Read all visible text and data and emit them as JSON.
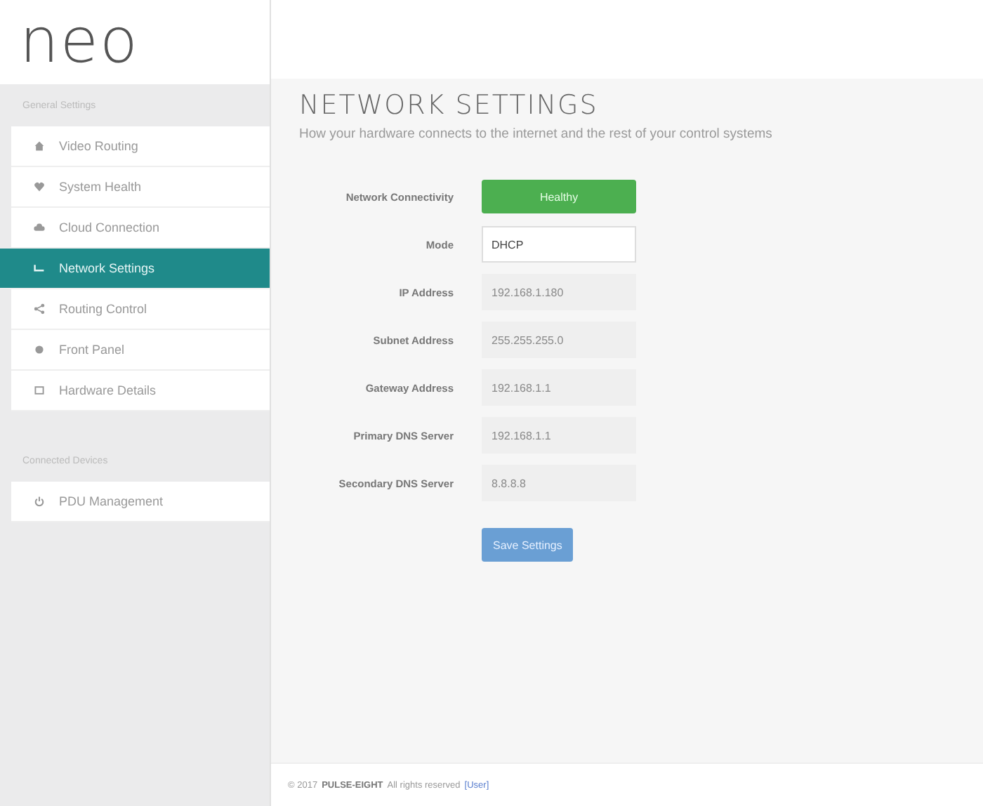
{
  "logo": {
    "text": "neo"
  },
  "sidebar": {
    "sections": [
      {
        "heading": "General Settings",
        "items": [
          {
            "label": "Video Routing",
            "selected": false
          },
          {
            "label": "System Health",
            "selected": false
          },
          {
            "label": "Cloud Connection",
            "selected": false
          },
          {
            "label": "Network Settings",
            "selected": true
          },
          {
            "label": "Routing Control",
            "selected": false
          },
          {
            "label": "Front Panel",
            "selected": false
          },
          {
            "label": "Hardware Details",
            "selected": false
          }
        ]
      },
      {
        "heading": "Connected Devices",
        "items": [
          {
            "label": "PDU Management",
            "selected": false
          }
        ]
      }
    ]
  },
  "page": {
    "title": "NETWORK SETTINGS",
    "subtitle": "How your hardware connects to the internet and the rest of your control systems"
  },
  "form": {
    "rows": [
      {
        "label": "Network Connectivity",
        "kind": "status",
        "value": "Healthy"
      },
      {
        "label": "Mode",
        "kind": "field",
        "value": "DHCP",
        "disabled": false
      },
      {
        "label": "IP Address",
        "kind": "field",
        "value": "192.168.1.180",
        "disabled": true
      },
      {
        "label": "Subnet Address",
        "kind": "field",
        "value": "255.255.255.0",
        "disabled": true
      },
      {
        "label": "Gateway Address",
        "kind": "field",
        "value": "192.168.1.1",
        "disabled": true
      },
      {
        "label": "Primary DNS Server",
        "kind": "field",
        "value": "192.168.1.1",
        "disabled": true
      },
      {
        "label": "Secondary DNS Server",
        "kind": "field",
        "value": "8.8.8.8",
        "disabled": true
      }
    ],
    "save_button": "Save Settings"
  },
  "footer": {
    "copyright": "© 2017",
    "brand": "PULSE-EIGHT",
    "rights": "All rights reserved",
    "link": "[User]"
  }
}
